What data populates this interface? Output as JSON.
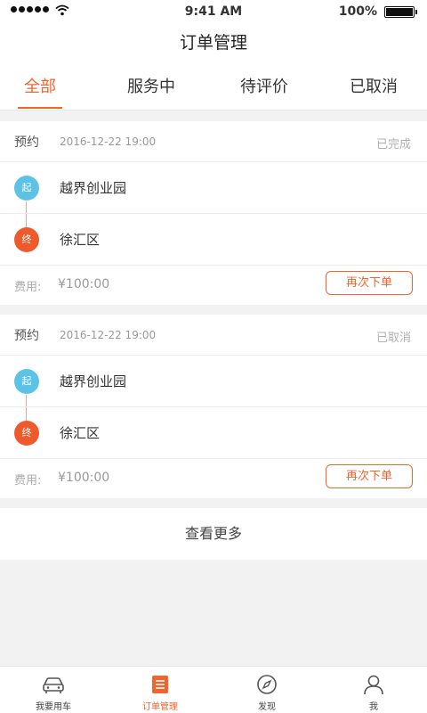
{
  "status_bar": {
    "time": "9:41 AM",
    "battery": "100%"
  },
  "header": {
    "title": "订单管理"
  },
  "tabs": [
    {
      "label": "全部",
      "active": true
    },
    {
      "label": "服务中",
      "active": false
    },
    {
      "label": "待评价",
      "active": false
    },
    {
      "label": "已取消",
      "active": false
    }
  ],
  "orders": [
    {
      "type": "预约",
      "datetime": "2016-12-22  19:00",
      "status": "已完成",
      "start_badge": "起",
      "start": "越界创业园",
      "end_badge": "终",
      "end": "徐汇区",
      "fee_label": "费用:",
      "fee": "¥100:00",
      "action": "再次下单"
    },
    {
      "type": "预约",
      "datetime": "2016-12-22  19:00",
      "status": "已取消",
      "start_badge": "起",
      "start": "越界创业园",
      "end_badge": "终",
      "end": "徐汇区",
      "fee_label": "费用:",
      "fee": "¥100:00",
      "action": "再次下单"
    }
  ],
  "more_label": "查看更多",
  "tabbar": [
    {
      "label": "我要用车",
      "icon": "car-icon",
      "active": false
    },
    {
      "label": "订单管理",
      "icon": "list-icon",
      "active": true
    },
    {
      "label": "发现",
      "icon": "compass-icon",
      "active": false
    },
    {
      "label": "我",
      "icon": "person-icon",
      "active": false
    }
  ],
  "colors": {
    "accent": "#f0642d",
    "start_badge": "#5cc2e6",
    "end_badge": "#ee5a2b"
  }
}
